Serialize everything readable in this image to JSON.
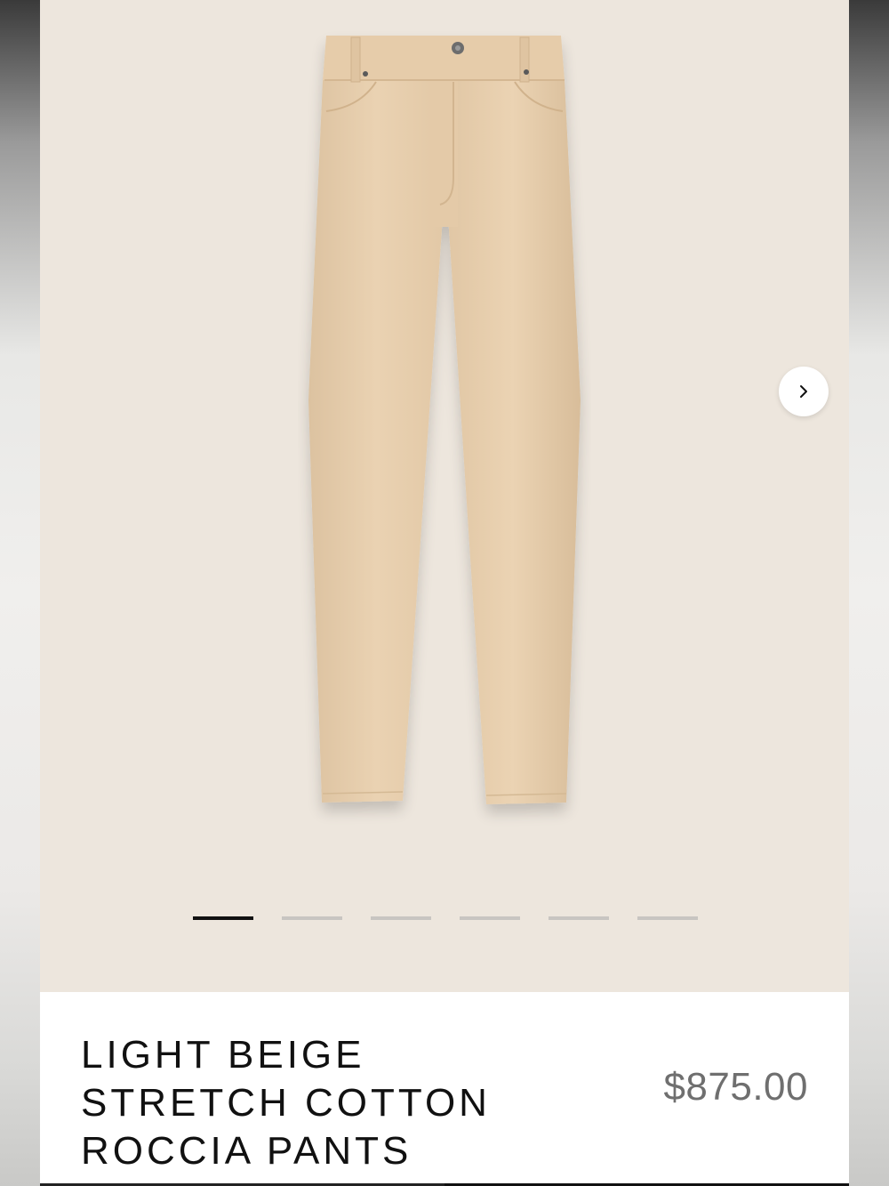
{
  "gallery": {
    "image_alt": "Light beige stretch cotton Roccia pants",
    "next_icon": "chevron-right-icon",
    "slide_count": 6,
    "active_slide": 1
  },
  "product": {
    "title_lines": [
      "LIGHT BEIGE",
      "STRETCH COTTON",
      "ROCCIA PANTS"
    ],
    "price": "$875.00"
  },
  "colors": {
    "gallery_bg": "#ede6dd",
    "pants": "#e8cfae",
    "price": "#6f6f6f",
    "active_indicator": "#111111",
    "inactive_indicator": "#c8c5c1"
  }
}
